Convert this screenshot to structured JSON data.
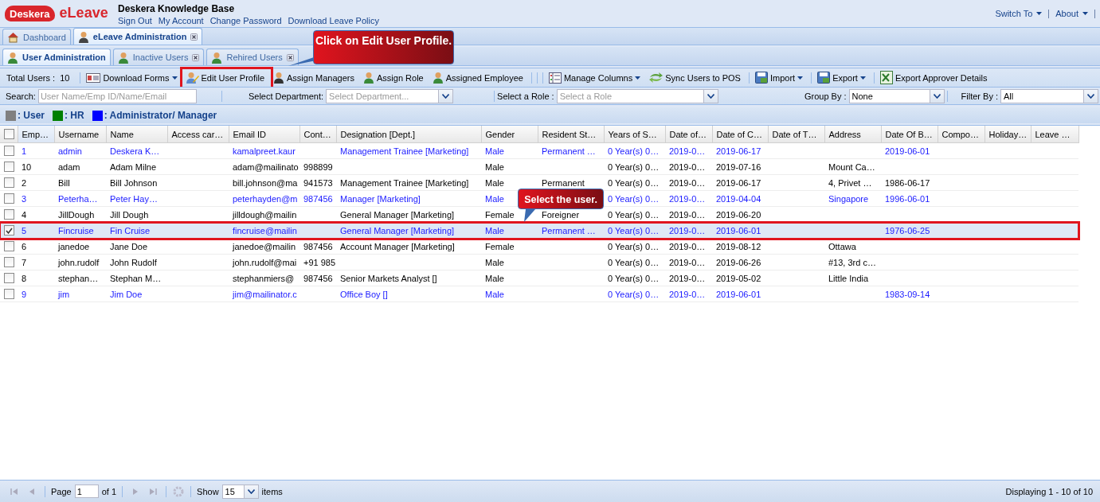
{
  "header": {
    "logo_text": "Deskera",
    "product": "eLeave",
    "title": "Deskera Knowledge Base",
    "links": [
      "Sign Out",
      "My Account",
      "Change Password",
      "Download Leave Policy"
    ],
    "menus": [
      "Switch To",
      "About"
    ]
  },
  "main_tabs": [
    {
      "label": "Dashboard",
      "selected": false,
      "closable": false,
      "kind": "home"
    },
    {
      "label": "eLeave Administration",
      "selected": true,
      "closable": true,
      "kind": "admin"
    }
  ],
  "sub_tabs": [
    {
      "label": "User Administration",
      "selected": true,
      "closable": false
    },
    {
      "label": "Inactive Users",
      "selected": false,
      "closable": true
    },
    {
      "label": "Rehired Users",
      "selected": false,
      "closable": true
    }
  ],
  "toolbar": {
    "total_label": "Total Users :",
    "total": "10",
    "buttons": [
      {
        "label": "Download Forms",
        "dropdown": true,
        "kind": "forms"
      },
      {
        "label": "Edit User Profile",
        "dropdown": false,
        "kind": "edit",
        "highlighted": true
      },
      {
        "label": "Assign Managers",
        "dropdown": false,
        "kind": "dark-person"
      },
      {
        "label": "Assign Role",
        "dropdown": false,
        "kind": "person"
      },
      {
        "label": "Assigned Employee",
        "dropdown": false,
        "kind": "person"
      },
      {
        "label": "Manage Columns",
        "dropdown": true,
        "kind": "columns"
      },
      {
        "label": "Sync Users to POS",
        "dropdown": false,
        "kind": "sync"
      },
      {
        "label": "Import",
        "dropdown": true,
        "kind": "disk"
      },
      {
        "label": "Export",
        "dropdown": true,
        "kind": "disk"
      },
      {
        "label": "Export Approver Details",
        "dropdown": false,
        "kind": "sheet"
      }
    ]
  },
  "filters": {
    "search": {
      "label": "Search:",
      "placeholder": "User Name/Emp ID/Name/Email"
    },
    "department": {
      "label": "Select Department:",
      "placeholder": "Select Department..."
    },
    "role": {
      "label": "Select a Role :",
      "placeholder": "Select a Role"
    },
    "group_by": {
      "label": "Group By :",
      "value": "None"
    },
    "filter_by": {
      "label": "Filter By :",
      "value": "All"
    }
  },
  "legend": [
    {
      "label": ": User",
      "color": "#808080"
    },
    {
      "label": ": HR",
      "color": "#008000"
    },
    {
      "label": ": Administrator/ Manager",
      "color": "#0000ff"
    }
  ],
  "table": {
    "all_selected": false,
    "columns": [
      "Emp…",
      "Username",
      "Name",
      "Access car…",
      "Email ID",
      "Cont…",
      "Designation [Dept.]",
      "Gender",
      "Resident St…",
      "Years of S…",
      "Date of…",
      "Date of C…",
      "Date of T…",
      "Address",
      "Date Of B…",
      "Compo…",
      "Holiday…",
      "Leave …"
    ],
    "rows": [
      {
        "selected": false,
        "kind": "admin",
        "cells": [
          "1",
          "admin",
          "Deskera K…",
          "",
          "kamalpreet.kaur",
          "",
          "Management Trainee [Marketing]",
          "Male",
          "Permanent …",
          "0 Year(s) 0…",
          "2019-0…",
          "2019-06-17",
          "",
          "",
          "2019-06-01",
          "",
          "",
          ""
        ]
      },
      {
        "selected": false,
        "kind": "user",
        "cells": [
          "10",
          "adam",
          "Adam Milne",
          "",
          "adam@mailinato",
          "998899",
          "",
          "Male",
          "",
          "0 Year(s) 0…",
          "2019-0…",
          "2019-07-16",
          "",
          "Mount Ca…",
          "",
          "",
          "",
          ""
        ]
      },
      {
        "selected": false,
        "kind": "user",
        "cells": [
          "2",
          "Bill",
          "Bill Johnson",
          "",
          "bill.johnson@ma",
          "941573",
          "Management Trainee [Marketing]",
          "Male",
          "Permanent",
          "0 Year(s) 0…",
          "2019-0…",
          "2019-06-17",
          "",
          "4, Privet …",
          "1986-06-17",
          "",
          "",
          ""
        ]
      },
      {
        "selected": false,
        "kind": "admin",
        "cells": [
          "3",
          "Peterha…",
          "Peter Hay…",
          "",
          "peterhayden@m",
          "987456",
          "Manager [Marketing]",
          "Male",
          "",
          "0 Year(s) 0…",
          "2019-0…",
          "2019-04-04",
          "",
          "Singapore",
          "1996-06-01",
          "",
          "",
          ""
        ]
      },
      {
        "selected": false,
        "kind": "user",
        "cells": [
          "4",
          "JillDough",
          "Jill Dough",
          "",
          "jilldough@mailin",
          "",
          "General Manager [Marketing]",
          "Female",
          "Foreigner",
          "0 Year(s) 0…",
          "2019-0…",
          "2019-06-20",
          "",
          "",
          "",
          "",
          "",
          ""
        ]
      },
      {
        "selected": true,
        "highlighted": true,
        "kind": "admin",
        "cells": [
          "5",
          "Fincruise",
          "Fin Cruise",
          "",
          "fincruise@mailin",
          "",
          "General Manager [Marketing]",
          "Male",
          "Permanent …",
          "0 Year(s) 0…",
          "2019-0…",
          "2019-06-01",
          "",
          "",
          "1976-06-25",
          "",
          "",
          ""
        ]
      },
      {
        "selected": false,
        "kind": "user",
        "cells": [
          "6",
          "janedoe",
          "Jane Doe",
          "",
          "janedoe@mailin",
          "987456",
          "Account Manager [Marketing]",
          "Female",
          "",
          "0 Year(s) 0…",
          "2019-0…",
          "2019-08-12",
          "",
          "Ottawa",
          "",
          "",
          "",
          ""
        ]
      },
      {
        "selected": false,
        "kind": "user",
        "cells": [
          "7",
          "john.rudolf",
          "John Rudolf",
          "",
          "john.rudolf@mai",
          "+91 985",
          "",
          "Male",
          "",
          "0 Year(s) 0…",
          "2019-0…",
          "2019-06-26",
          "",
          "#13, 3rd c…",
          "",
          "",
          "",
          ""
        ]
      },
      {
        "selected": false,
        "kind": "user",
        "cells": [
          "8",
          "stephan…",
          "Stephan M…",
          "",
          "stephanmiers@",
          "987456",
          "Senior Markets Analyst []",
          "Male",
          "",
          "0 Year(s) 0…",
          "2019-0…",
          "2019-05-02",
          "",
          "Little India",
          "",
          "",
          "",
          ""
        ]
      },
      {
        "selected": false,
        "kind": "admin",
        "cells": [
          "9",
          "jim",
          "Jim Doe",
          "",
          "jim@mailinator.c",
          "",
          "Office Boy []",
          "Male",
          "",
          "0 Year(s) 0…",
          "2019-0…",
          "2019-06-01",
          "",
          "",
          "1983-09-14",
          "",
          "",
          ""
        ]
      }
    ]
  },
  "pager": {
    "page_label": "Page",
    "page": "1",
    "of_label": "of 1",
    "show_label": "Show",
    "page_size": "15",
    "items_label": "items",
    "display": "Displaying 1 - 10 of 10"
  },
  "callouts": [
    {
      "text": "Click on Edit User Profile."
    },
    {
      "text": "Select the user."
    }
  ]
}
